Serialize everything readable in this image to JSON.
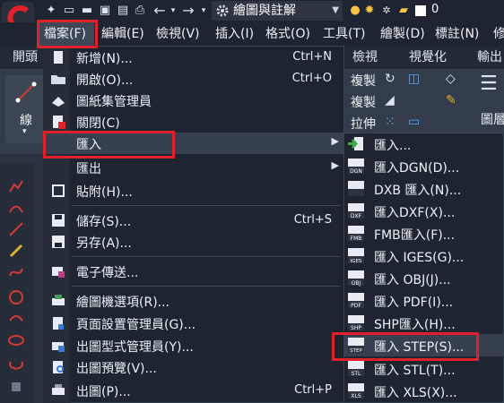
{
  "workspace": "繪圖與註解",
  "layer_count": "0",
  "menubar": [
    {
      "label": "檔案(F)",
      "active": true
    },
    {
      "label": "編輯(E)"
    },
    {
      "label": "檢視(V)"
    },
    {
      "label": "插入(I)"
    },
    {
      "label": "格式(O)"
    },
    {
      "label": "工具(T)"
    },
    {
      "label": "繪製(D)"
    },
    {
      "label": "標註(N)"
    },
    {
      "label": "修"
    }
  ],
  "ribbon_tabs": [
    "開頭",
    "檢視",
    "視覺化",
    "輸出"
  ],
  "ribbon": {
    "line_label": "線",
    "copy1": "複製",
    "copy2": "複製",
    "stretch": "拉伸",
    "image": "圖層"
  },
  "file_menu": [
    {
      "label": "新增(N)...",
      "shortcut": "Ctrl+N",
      "icon": "new-file-icon"
    },
    {
      "label": "開啟(O)...",
      "shortcut": "Ctrl+O",
      "icon": "open-folder-icon"
    },
    {
      "label": "圖紙集管理員",
      "icon": "sheet-set-icon"
    },
    {
      "label": "關閉(C)",
      "icon": "close-file-icon"
    },
    {
      "label": "匯入",
      "submenu": true,
      "highlighted": true
    },
    {
      "label": "匯出",
      "submenu": true
    },
    {
      "label": "貼附(H)...",
      "icon": "attach-icon"
    },
    {
      "label": "儲存(S)...",
      "shortcut": "Ctrl+S",
      "icon": "save-icon"
    },
    {
      "label": "另存(A)...",
      "icon": "save-as-icon"
    },
    {
      "label": "電子傳送...",
      "icon": "etransmit-icon"
    },
    {
      "label": "繪圖機選項(R)...",
      "icon": "plotter-icon"
    },
    {
      "label": "頁面設置管理員(G)...",
      "icon": "page-setup-icon"
    },
    {
      "label": "出圖型式管理員(Y)...",
      "icon": "plot-style-icon"
    },
    {
      "label": "出圖預覽(V)...",
      "icon": "plot-preview-icon"
    },
    {
      "label": "出圖(P)...",
      "shortcut": "Ctrl+P",
      "icon": "plot-icon"
    }
  ],
  "import_menu": [
    {
      "label": "匯入...",
      "tag": ""
    },
    {
      "label": "匯入DGN(D)...",
      "tag": "DGN"
    },
    {
      "label": "DXB 匯入(N)...",
      "tag": "DXB"
    },
    {
      "label": "匯入DXF(X)...",
      "tag": "DXF"
    },
    {
      "label": "FMB匯入(F)...",
      "tag": "FMB"
    },
    {
      "label": "匯入 IGES(G)...",
      "tag": "IGES"
    },
    {
      "label": "匯入 OBJ(J)...",
      "tag": "OBJ"
    },
    {
      "label": "匯入 PDF(I)...",
      "tag": "PDF"
    },
    {
      "label": "SHP匯入(H)...",
      "tag": "SHP"
    },
    {
      "label": "匯入 STEP(S)...",
      "tag": "STEP",
      "highlighted": true
    },
    {
      "label": "匯入 STL(T)...",
      "tag": "STL"
    },
    {
      "label": "匯入 XLS(X)...",
      "tag": "XLS"
    }
  ],
  "colors": {
    "accent_red": "#e0212b",
    "menu_bg": "#1e2530",
    "highlight": "#36404f"
  }
}
